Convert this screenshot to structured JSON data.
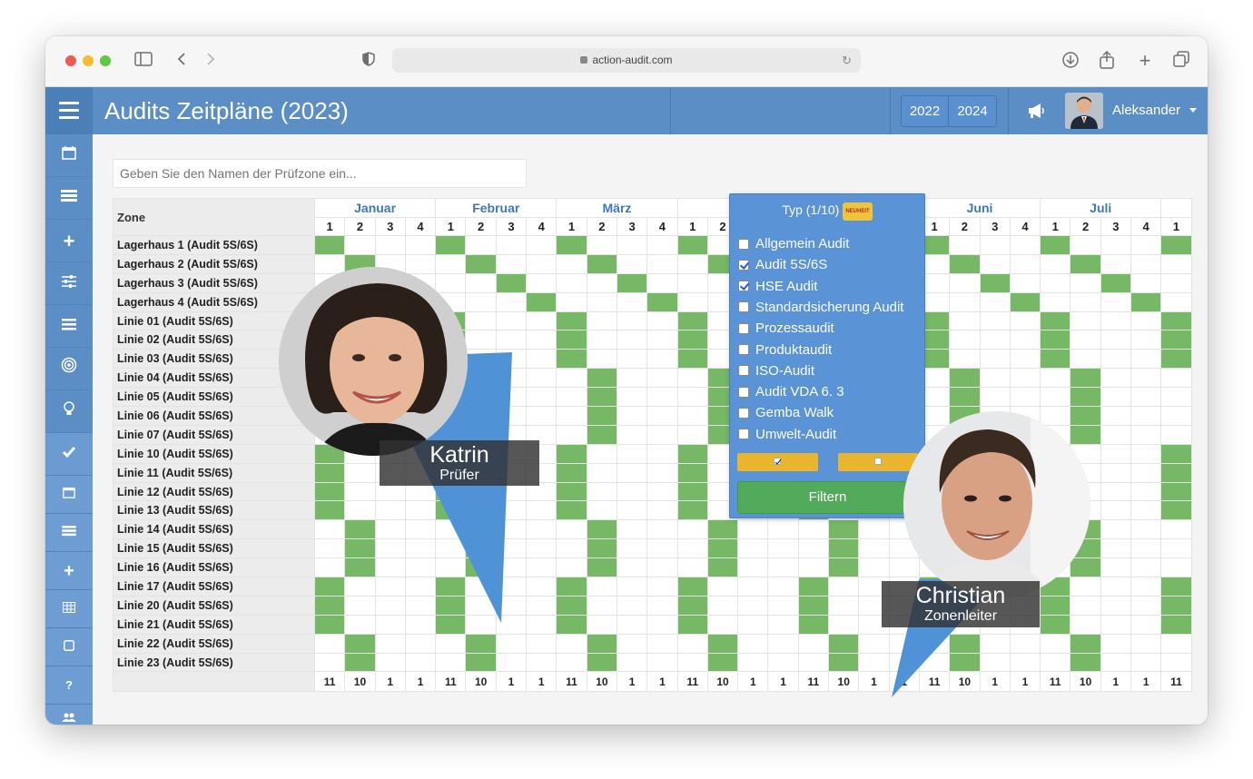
{
  "browser": {
    "url": "action-audit.com"
  },
  "header": {
    "title": "Audits Zeitpläne (2023)",
    "years": [
      "2022",
      "2024"
    ],
    "user_name": "Aleksander"
  },
  "search": {
    "placeholder": "Geben Sie den Namen der Prüfzone ein..."
  },
  "type_filter": {
    "title": "Typ (1/10)",
    "badge": "NEUHEIT",
    "options": [
      {
        "label": "Allgemein Audit",
        "checked": false
      },
      {
        "label": "Audit 5S/6S",
        "checked": true
      },
      {
        "label": "HSE Audit",
        "checked": true
      },
      {
        "label": "Standardsicherung Audit",
        "checked": false
      },
      {
        "label": "Prozessaudit",
        "checked": false
      },
      {
        "label": "Produktaudit",
        "checked": false
      },
      {
        "label": "ISO-Audit",
        "checked": false
      },
      {
        "label": "Audit VDA 6. 3",
        "checked": false
      },
      {
        "label": "Gemba Walk",
        "checked": false
      },
      {
        "label": "Umwelt-Audit",
        "checked": false
      }
    ],
    "filter_label": "Filtern"
  },
  "table": {
    "zone_header": "Zone",
    "months": [
      "Januar",
      "Februar",
      "März",
      "",
      "",
      "Juni",
      "Juli",
      ""
    ],
    "weeks": [
      "1",
      "2",
      "3",
      "4",
      "1",
      "2",
      "3",
      "4",
      "1",
      "2",
      "3",
      "4",
      "1",
      "2",
      "3",
      "4",
      "1",
      "2",
      "3",
      "4",
      "1",
      "2",
      "3",
      "4",
      "1",
      "2",
      "3",
      "4",
      "1"
    ],
    "rows": [
      {
        "label": "Lagerhaus 1 (Audit 5S/6S)",
        "cells": [
          1,
          0,
          0,
          0,
          1,
          0,
          0,
          0,
          1,
          0,
          0,
          0,
          1,
          0,
          0,
          0,
          1,
          0,
          0,
          0,
          1,
          0,
          0,
          0,
          1,
          0,
          0,
          0,
          1
        ]
      },
      {
        "label": "Lagerhaus 2 (Audit 5S/6S)",
        "cells": [
          0,
          1,
          0,
          0,
          0,
          1,
          0,
          0,
          0,
          1,
          0,
          0,
          0,
          1,
          0,
          0,
          0,
          1,
          0,
          0,
          0,
          1,
          0,
          0,
          0,
          1,
          0,
          0,
          0
        ]
      },
      {
        "label": "Lagerhaus 3 (Audit 5S/6S)",
        "cells": [
          0,
          0,
          1,
          0,
          0,
          0,
          1,
          0,
          0,
          0,
          1,
          0,
          0,
          0,
          1,
          0,
          0,
          0,
          1,
          0,
          0,
          0,
          1,
          0,
          0,
          0,
          1,
          0,
          0
        ]
      },
      {
        "label": "Lagerhaus 4 (Audit 5S/6S)",
        "cells": [
          0,
          0,
          0,
          1,
          0,
          0,
          0,
          1,
          0,
          0,
          0,
          1,
          0,
          0,
          0,
          1,
          0,
          0,
          0,
          1,
          0,
          0,
          0,
          1,
          0,
          0,
          0,
          1,
          0
        ]
      },
      {
        "label": "Linie 01 (Audit 5S/6S)",
        "cells": [
          1,
          0,
          0,
          0,
          1,
          0,
          0,
          0,
          1,
          0,
          0,
          0,
          1,
          0,
          0,
          0,
          1,
          0,
          0,
          0,
          1,
          0,
          0,
          0,
          1,
          0,
          0,
          0,
          1
        ]
      },
      {
        "label": "Linie 02 (Audit 5S/6S)",
        "cells": [
          1,
          0,
          0,
          0,
          1,
          0,
          0,
          0,
          1,
          0,
          0,
          0,
          1,
          0,
          0,
          0,
          1,
          0,
          0,
          0,
          1,
          0,
          0,
          0,
          1,
          0,
          0,
          0,
          1
        ]
      },
      {
        "label": "Linie 03 (Audit 5S/6S)",
        "cells": [
          1,
          0,
          0,
          0,
          1,
          0,
          0,
          0,
          1,
          0,
          0,
          0,
          1,
          0,
          0,
          0,
          1,
          0,
          0,
          0,
          1,
          0,
          0,
          0,
          1,
          0,
          0,
          0,
          1
        ]
      },
      {
        "label": "Linie 04 (Audit 5S/6S)",
        "cells": [
          0,
          1,
          0,
          0,
          0,
          1,
          0,
          0,
          0,
          1,
          0,
          0,
          0,
          1,
          0,
          0,
          0,
          1,
          0,
          0,
          0,
          1,
          0,
          0,
          0,
          1,
          0,
          0,
          0
        ]
      },
      {
        "label": "Linie 05 (Audit 5S/6S)",
        "cells": [
          0,
          1,
          0,
          0,
          0,
          1,
          0,
          0,
          0,
          1,
          0,
          0,
          0,
          1,
          0,
          0,
          0,
          1,
          0,
          0,
          0,
          1,
          0,
          0,
          0,
          1,
          0,
          0,
          0
        ]
      },
      {
        "label": "Linie 06 (Audit 5S/6S)",
        "cells": [
          0,
          1,
          0,
          0,
          0,
          1,
          0,
          0,
          0,
          1,
          0,
          0,
          0,
          1,
          0,
          0,
          0,
          1,
          0,
          0,
          0,
          1,
          0,
          0,
          0,
          1,
          0,
          0,
          0
        ]
      },
      {
        "label": "Linie 07 (Audit 5S/6S)",
        "cells": [
          0,
          1,
          0,
          0,
          0,
          1,
          0,
          0,
          0,
          1,
          0,
          0,
          0,
          1,
          0,
          0,
          0,
          1,
          0,
          0,
          0,
          1,
          0,
          0,
          0,
          1,
          0,
          0,
          0
        ]
      },
      {
        "label": "Linie 10 (Audit 5S/6S)",
        "cells": [
          1,
          0,
          0,
          0,
          1,
          0,
          0,
          0,
          1,
          0,
          0,
          0,
          1,
          0,
          0,
          0,
          1,
          0,
          0,
          0,
          1,
          0,
          0,
          0,
          1,
          0,
          0,
          0,
          1
        ]
      },
      {
        "label": "Linie 11 (Audit 5S/6S)",
        "cells": [
          1,
          0,
          0,
          0,
          1,
          0,
          0,
          0,
          1,
          0,
          0,
          0,
          1,
          0,
          0,
          0,
          1,
          0,
          0,
          0,
          1,
          0,
          0,
          0,
          1,
          0,
          0,
          0,
          1
        ]
      },
      {
        "label": "Linie 12 (Audit 5S/6S)",
        "cells": [
          1,
          0,
          0,
          0,
          1,
          0,
          0,
          0,
          1,
          0,
          0,
          0,
          1,
          0,
          0,
          0,
          1,
          0,
          0,
          0,
          1,
          0,
          0,
          0,
          1,
          0,
          0,
          0,
          1
        ]
      },
      {
        "label": "Linie 13 (Audit 5S/6S)",
        "cells": [
          1,
          0,
          0,
          0,
          1,
          0,
          0,
          0,
          1,
          0,
          0,
          0,
          1,
          0,
          0,
          0,
          1,
          0,
          0,
          0,
          1,
          0,
          0,
          0,
          1,
          0,
          0,
          0,
          1
        ]
      },
      {
        "label": "Linie 14 (Audit 5S/6S)",
        "cells": [
          0,
          1,
          0,
          0,
          0,
          1,
          0,
          0,
          0,
          1,
          0,
          0,
          0,
          1,
          0,
          0,
          0,
          1,
          0,
          0,
          0,
          1,
          0,
          0,
          0,
          1,
          0,
          0,
          0
        ]
      },
      {
        "label": "Linie 15 (Audit 5S/6S)",
        "cells": [
          0,
          1,
          0,
          0,
          0,
          1,
          0,
          0,
          0,
          1,
          0,
          0,
          0,
          1,
          0,
          0,
          0,
          1,
          0,
          0,
          0,
          1,
          0,
          0,
          0,
          1,
          0,
          0,
          0
        ]
      },
      {
        "label": "Linie 16 (Audit 5S/6S)",
        "cells": [
          0,
          1,
          0,
          0,
          0,
          1,
          0,
          0,
          0,
          1,
          0,
          0,
          0,
          1,
          0,
          0,
          0,
          1,
          0,
          0,
          0,
          1,
          0,
          0,
          0,
          1,
          0,
          0,
          0
        ]
      },
      {
        "label": "Linie 17 (Audit 5S/6S)",
        "cells": [
          1,
          0,
          0,
          0,
          1,
          0,
          0,
          0,
          1,
          0,
          0,
          0,
          1,
          0,
          0,
          0,
          1,
          0,
          0,
          0,
          1,
          0,
          0,
          0,
          1,
          0,
          0,
          0,
          1
        ]
      },
      {
        "label": "Linie 20 (Audit 5S/6S)",
        "cells": [
          1,
          0,
          0,
          0,
          1,
          0,
          0,
          0,
          1,
          0,
          0,
          0,
          1,
          0,
          0,
          0,
          1,
          0,
          0,
          0,
          1,
          0,
          0,
          0,
          1,
          0,
          0,
          0,
          1
        ]
      },
      {
        "label": "Linie 21 (Audit 5S/6S)",
        "cells": [
          1,
          0,
          0,
          0,
          1,
          0,
          0,
          0,
          1,
          0,
          0,
          0,
          1,
          0,
          0,
          0,
          1,
          0,
          0,
          0,
          1,
          0,
          0,
          0,
          1,
          0,
          0,
          0,
          1
        ]
      },
      {
        "label": "Linie 22 (Audit 5S/6S)",
        "cells": [
          0,
          1,
          0,
          0,
          0,
          1,
          0,
          0,
          0,
          1,
          0,
          0,
          0,
          1,
          0,
          0,
          0,
          1,
          0,
          0,
          0,
          1,
          0,
          0,
          0,
          1,
          0,
          0,
          0
        ]
      },
      {
        "label": "Linie 23 (Audit 5S/6S)",
        "cells": [
          0,
          1,
          0,
          0,
          0,
          1,
          0,
          0,
          0,
          1,
          0,
          0,
          0,
          1,
          0,
          0,
          0,
          1,
          0,
          0,
          0,
          1,
          0,
          0,
          0,
          1,
          0,
          0,
          0
        ]
      }
    ],
    "totals": [
      "11",
      "10",
      "1",
      "1",
      "11",
      "10",
      "1",
      "1",
      "11",
      "10",
      "1",
      "1",
      "11",
      "10",
      "1",
      "1",
      "11",
      "10",
      "1",
      "1",
      "11",
      "10",
      "1",
      "1",
      "11",
      "10",
      "1",
      "1",
      "11"
    ],
    "on_color": "#76b865"
  },
  "callouts": {
    "katrin": {
      "name": "Katrin",
      "role": "Prüfer"
    },
    "christian": {
      "name": "Christian",
      "role": "Zonenleiter"
    }
  },
  "sidebar": {
    "icons": [
      "calendar-icon",
      "list-icon",
      "plus-icon",
      "sliders-icon",
      "menu-icon",
      "target-icon",
      "lightbulb-icon",
      "check-icon",
      "calendar-icon",
      "list-icon",
      "plus-icon",
      "table-icon",
      "square-icon",
      "help-icon",
      "users-icon"
    ]
  }
}
